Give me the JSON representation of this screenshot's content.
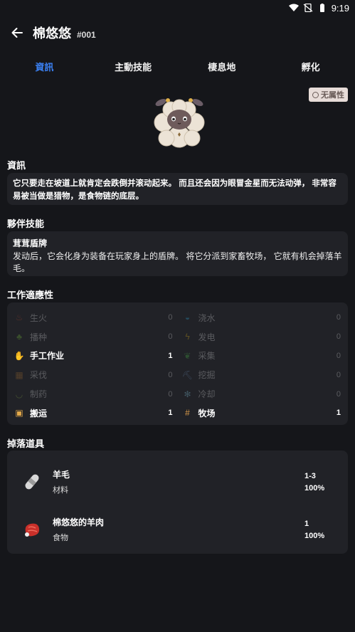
{
  "status_bar": {
    "time": "9:19"
  },
  "header": {
    "title": "棉悠悠",
    "number": "#001"
  },
  "tabs": [
    {
      "label": "資訊",
      "active": true
    },
    {
      "label": "主動技能",
      "active": false
    },
    {
      "label": "棲息地",
      "active": false
    },
    {
      "label": "孵化",
      "active": false
    }
  ],
  "element_badge": "无属性",
  "info": {
    "heading": "資訊",
    "description": "它只要走在坡道上就肯定会跌倒并滚动起来。 而且还会因为眼冒金星而无法动弹， 非常容易被当做是猎物，是食物链的底层。"
  },
  "partner_skill": {
    "heading": "夥伴技能",
    "name": "茸茸盾牌",
    "description": "发动后，它会化身为装备在玩家身上的盾牌。 将它分派到家畜牧场， 它就有机会掉落羊毛。"
  },
  "work": {
    "heading": "工作適應性",
    "items": [
      {
        "name": "生火",
        "value": "0",
        "icon": "fire-icon",
        "color": "#e0542e"
      },
      {
        "name": "浇水",
        "value": "0",
        "icon": "water-icon",
        "color": "#2fb6e8"
      },
      {
        "name": "播种",
        "value": "0",
        "icon": "sprout-icon",
        "color": "#7cc23a"
      },
      {
        "name": "发电",
        "value": "0",
        "icon": "lightning-icon",
        "color": "#f4c21a"
      },
      {
        "name": "手工作业",
        "value": "1",
        "icon": "hand-icon",
        "color": "#f2b640"
      },
      {
        "name": "采集",
        "value": "0",
        "icon": "leaf-icon",
        "color": "#4cbf4a"
      },
      {
        "name": "采伐",
        "value": "0",
        "icon": "logs-icon",
        "color": "#d58a34"
      },
      {
        "name": "挖掘",
        "value": "0",
        "icon": "pickaxe-icon",
        "color": "#7ea6d8"
      },
      {
        "name": "制药",
        "value": "0",
        "icon": "medicine-bowl-icon",
        "color": "#9bc24a"
      },
      {
        "name": "冷却",
        "value": "0",
        "icon": "snowflake-icon",
        "color": "#8fd8f2"
      },
      {
        "name": "搬运",
        "value": "1",
        "icon": "box-icon",
        "color": "#e3a94a"
      },
      {
        "name": "牧场",
        "value": "1",
        "icon": "fence-icon",
        "color": "#d99a4a"
      }
    ]
  },
  "drops": {
    "heading": "掉落道具",
    "items": [
      {
        "name": "羊毛",
        "category": "材料",
        "quantity": "1-3",
        "rate": "100%",
        "icon": "wool-icon"
      },
      {
        "name": "棉悠悠的羊肉",
        "category": "食物",
        "quantity": "1",
        "rate": "100%",
        "icon": "meat-icon"
      }
    ]
  }
}
